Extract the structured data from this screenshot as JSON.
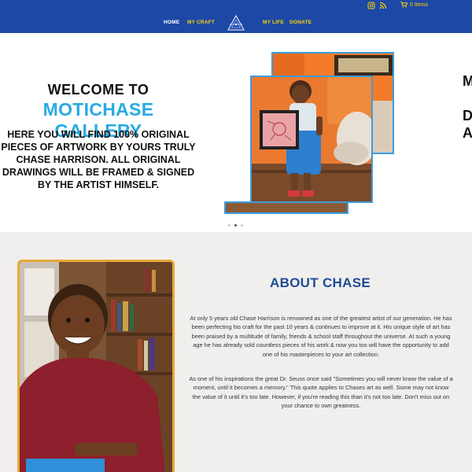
{
  "topbar": {
    "icons": [
      "instagram-icon",
      "rss-icon"
    ],
    "cart_label": "0 Items"
  },
  "nav": {
    "items": [
      {
        "label": "HOME",
        "active": true
      },
      {
        "label": "MY CRAFT",
        "active": false
      },
      {
        "label": "MY LIFE",
        "active": false
      },
      {
        "label": "DONATE",
        "active": false
      }
    ]
  },
  "hero": {
    "welcome": "WELCOME TO",
    "gallery_name": "MOTICHASE GALLERY",
    "description": "HERE YOU WILL FIND 100% ORIGINAL PIECES OF ARTWORK BY YOURS TRULY CHASE HARRISON. ALL ORIGINAL DRAWINGS WILL BE FRAMED & SIGNED BY THE ARTIST HIMSELF.",
    "next_slide_peek": "M\n\nD\nA",
    "slide_count": 3,
    "active_slide": 2
  },
  "about": {
    "heading": "ABOUT CHASE",
    "paragraph1": "At only 5 years old Chase Harrison is renowned as one of the greatest artist of our generation. He has been perfecting his craft for the past 10 years & continues to improve at it. His unique style of art has been praised by a multitude of family, friends & school staff throughout the universe. At such a young age he has already sold countless pieces of his work & now you too will have the opportunity to add one of his masterpieces to your art collection.",
    "paragraph2": "As one of his inspirations the great Dr. Seuss once said \"Sometimes you will never know the value of a moment, until it becomes a memory.\" This quote applies to Chases art as well. Some may not know the value of it until it's too late. However, if you're reading this than it's not too late. Don't miss out on your chance to own greatness."
  },
  "colors": {
    "nav_bg": "#1e48a5",
    "nav_link": "#ffd400",
    "accent_blue": "#29abe2",
    "heading_blue": "#1e4b96",
    "frame_gold": "#e8a838"
  }
}
